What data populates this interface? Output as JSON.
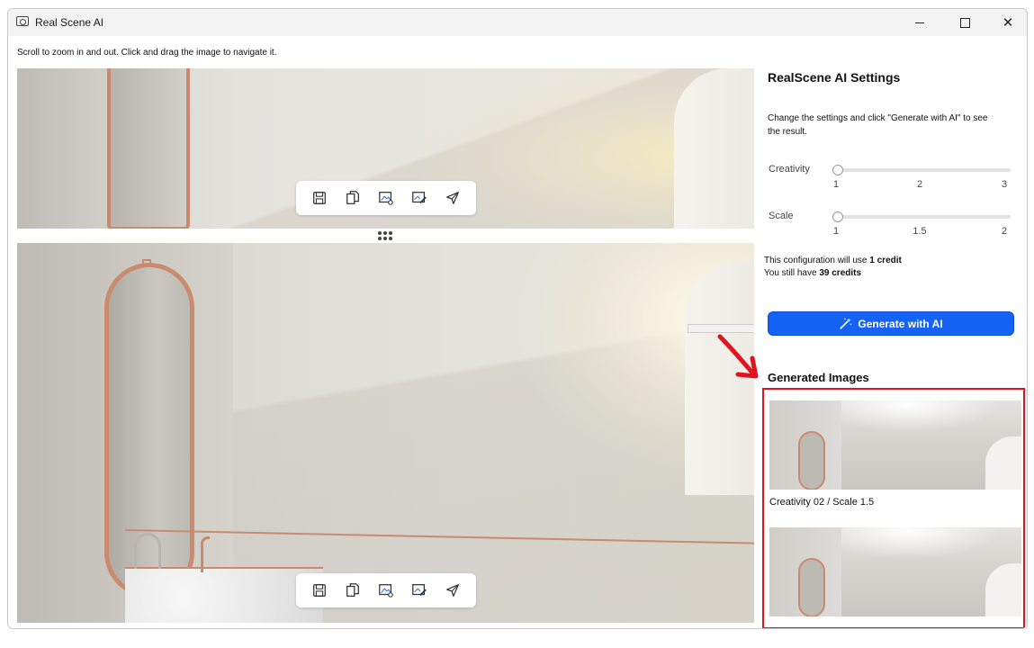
{
  "window": {
    "title": "Real Scene AI"
  },
  "instructions": "Scroll to zoom in and out. Click and drag the image to navigate it.",
  "toolbar_icons": [
    "save-icon",
    "copy-icon",
    "image-settings-icon",
    "edit-image-icon",
    "send-icon"
  ],
  "settings": {
    "title": "RealScene AI Settings",
    "description": "Change the settings and click \"Generate with AI\" to see the result.",
    "creativity": {
      "label": "Creativity",
      "ticks": [
        "1",
        "2",
        "3"
      ],
      "value": 1
    },
    "scale": {
      "label": "Scale",
      "ticks": [
        "1",
        "1.5",
        "2"
      ],
      "value": 1
    },
    "credit_line_prefix": "This configuration will use",
    "credit_line_value": "1 credit",
    "remaining_prefix": "You still have",
    "remaining_value": "39  credits",
    "generate_label": "Generate with AI"
  },
  "generated": {
    "title": "Generated Images",
    "items": [
      {
        "caption": "Creativity 02 / Scale 1.5"
      }
    ]
  },
  "colors": {
    "accent": "#1563f5",
    "highlight": "#e0141e",
    "brass": "#c98a6e"
  }
}
